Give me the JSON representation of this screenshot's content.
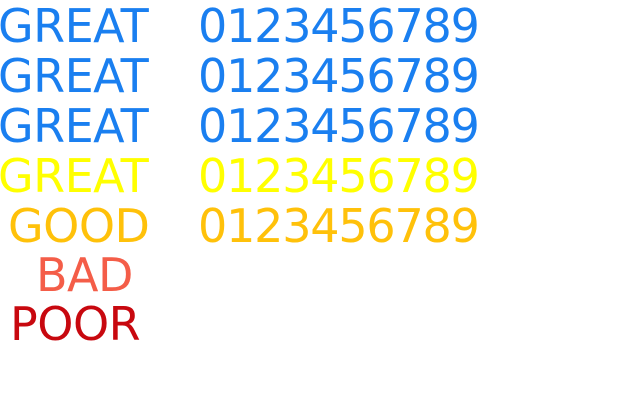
{
  "rows": [
    {
      "label": "GREAT",
      "digits": "0123456789",
      "color": "#1a7ff0"
    },
    {
      "label": "GREAT",
      "digits": "0123456789",
      "color": "#1a7ff0"
    },
    {
      "label": "GREAT",
      "digits": "0123456789",
      "color": "#1a7ff0"
    },
    {
      "label": "GREAT",
      "digits": "0123456789",
      "color": "#ffff00"
    },
    {
      "label": "GOOD",
      "digits": "0123456789",
      "color": "#ffc10a"
    },
    {
      "label": "BAD",
      "digits": "",
      "color": "#f45d48"
    },
    {
      "label": "POOR",
      "digits": "",
      "color": "#c8080f"
    }
  ]
}
